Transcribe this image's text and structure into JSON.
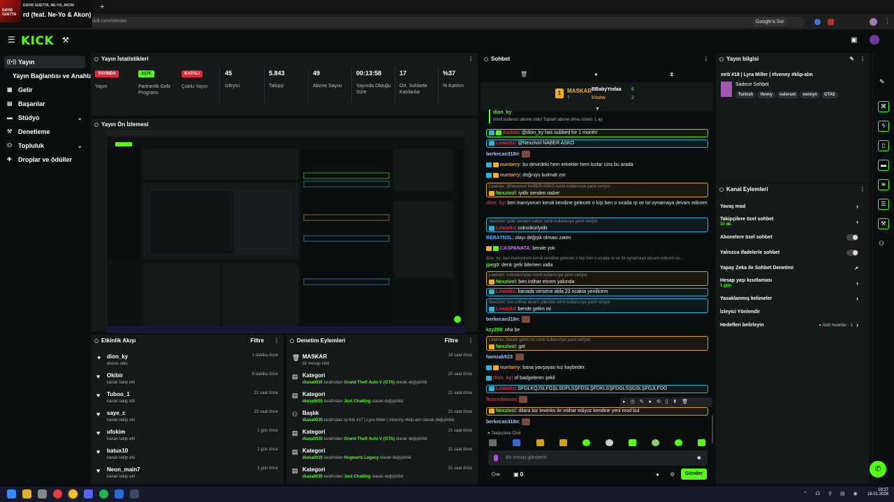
{
  "media": {
    "artist": "DAVID GUETTA, NE-YO, AKON",
    "song": "rd (feat. Ne-Yo & Akon)",
    "art_label": "DAVID GUETTA"
  },
  "browser": {
    "url": "dashboard.kick.com/stream",
    "ask_label": "Google'a Sor"
  },
  "brand": {
    "logo": "KICK",
    "accent": "#53fc18"
  },
  "sidebar": {
    "items": [
      {
        "label": "Yayın",
        "icon": "broadcast-icon"
      },
      {
        "label": "Yayın Bağlantısı ve Anahtarı"
      },
      {
        "label": "Gelir",
        "icon": "grid-icon"
      },
      {
        "label": "Başarılar",
        "icon": "trophy-icon"
      },
      {
        "label": "Stüdyo",
        "icon": "studio-icon",
        "expand": true
      },
      {
        "label": "Denetleme",
        "icon": "wrench-icon"
      },
      {
        "label": "Topluluk",
        "icon": "people-icon",
        "expand": true
      },
      {
        "label": "Droplar ve ödüller",
        "icon": "gift-icon"
      }
    ]
  },
  "stats": {
    "title": "Yayın İstatistikleri",
    "items": [
      {
        "badge": "YAYINDA",
        "label": "Yayın",
        "color": "#e0283a"
      },
      {
        "badge": "AÇIK",
        "label": "Partnerlik Gelir Programı",
        "color": "#53fc18"
      },
      {
        "badge": "KAPALI",
        "label": "Çoklu Yayın",
        "color": "#e0283a"
      },
      {
        "value": "45",
        "label": "İzleyici"
      },
      {
        "value": "5.843",
        "label": "Takipçi"
      },
      {
        "value": "49",
        "label": "Abone Sayısı"
      },
      {
        "value": "00:13:58",
        "label": "Yayında Olduğu Süre"
      },
      {
        "value": "17",
        "label": "Ort. Sohbete Katılanlar"
      },
      {
        "value": "%37",
        "label": "% Katılım"
      }
    ]
  },
  "preview": {
    "title": "Yayın Ön İzlemesi"
  },
  "activity": {
    "title": "Etkinlik Akışı",
    "filter": "Filtre",
    "items": [
      {
        "name": "dion_ky",
        "sub": "abone oldu",
        "time": "1 dakika önce",
        "icon": "star-icon"
      },
      {
        "name": "Okibir",
        "sub": "kanalı takip etti",
        "time": "8 dakika önce",
        "icon": "heart-icon"
      },
      {
        "name": "Tuboo_1",
        "sub": "kanalı takip etti",
        "time": "21 saat önce",
        "icon": "heart-icon"
      },
      {
        "name": "saye_c",
        "sub": "kanalı takip etti",
        "time": "23 saat önce",
        "icon": "heart-icon"
      },
      {
        "name": "ufokim",
        "sub": "kanalı takip etti",
        "time": "1 gün önce",
        "icon": "heart-icon"
      },
      {
        "name": "batux10",
        "sub": "kanalı takip etti",
        "time": "1 gün önce",
        "icon": "heart-icon"
      },
      {
        "name": "Neon_main7",
        "sub": "kanalı takip etti",
        "time": "1 gün önce",
        "icon": "heart-icon"
      }
    ]
  },
  "moderation": {
    "title": "Denetim Eylemleri",
    "filter": "Filtre",
    "items": [
      {
        "title": "MASKAR",
        "user": "",
        "mid": "bir mesajı sildi",
        "target": "",
        "end": "",
        "time": "19 saat önce"
      },
      {
        "title": "Kategori",
        "user": "diana0035",
        "mid": " tarafından ",
        "target": "Grand Theft Auto V (GTA)",
        "end": " olarak değiştirildi",
        "time": "20 saat önce"
      },
      {
        "title": "Kategori",
        "user": "diana0035",
        "mid": " tarafından ",
        "target": "Just Chatting",
        "end": " olarak değiştirildi",
        "time": "21 saat önce"
      },
      {
        "title": "Başlık",
        "user": "diana0035",
        "mid": " tarafından ",
        "target": "",
        "end": "rp link #17 | Lyra Miller | #lvenny #klip-alın olarak değiştirildi",
        "time": "21 saat önce"
      },
      {
        "title": "Kategori",
        "user": "diana0035",
        "mid": " tarafından ",
        "target": "Grand Theft Auto V (GTA)",
        "end": " olarak değiştirildi",
        "time": "21 saat önce"
      },
      {
        "title": "Kategori",
        "user": "diana0035",
        "mid": " tarafından ",
        "target": "Hogwarts Legacy",
        "end": " olarak değiştirildi",
        "time": "21 saat önce"
      },
      {
        "title": "Kategori",
        "user": "diana0035",
        "mid": " tarafından ",
        "target": "Just Chatting",
        "end": " olarak değiştirildi",
        "time": "21 saat önce"
      }
    ]
  },
  "chat": {
    "title": "Sohbet",
    "gifters": {
      "first": "MASKAR",
      "first_count": "7",
      "second": "BBabyYodaa",
      "second_count": "6",
      "third": "kitatw",
      "third_count": "2"
    },
    "pinned_user": "dion_ky",
    "pinned_text": "isimli kullanıcı abone oldu! Toplam abone olma süresi: 1 ay.",
    "messages": [
      {
        "user": "Kickibi",
        "ucolor": "#e0283a",
        "text": ": @dion_ky has subbed for 1 month!",
        "style": "hl-g"
      },
      {
        "user": "Lewinks",
        "ucolor": "#e0283a",
        "text": ": @Nexzivol NABER ASKO",
        "style": "hl-b"
      },
      {
        "user": "berkecan318n",
        "ucolor": "#9fc4ff",
        "text": ":",
        "emote": true
      },
      {
        "user": "nuntarry",
        "ucolor": "#f0a020",
        "text": ": bu devirdeki hem erkekler hem kızlar cins bu arada"
      },
      {
        "user": "nuntarry",
        "ucolor": "#f0a020",
        "text": ": doğruyu bulmak zor"
      },
      {
        "reply": "Lewinks: @Nexzivol NABER ASKO isimli kullanıcıya yanıt veriyor",
        "user": "Nexzivol",
        "ucolor": "#53fc18",
        "text": ": iyidir senden naber",
        "style": "hl-y"
      },
      {
        "user": "dion_ky",
        "ucolor": "#e0283a",
        "text": ": ben inanıyorum kendi kendine gelecek o kişi ben o sırada rp ve lol oynamaya devam edicem",
        "wrap": true
      },
      {
        "reply": "Nexzivol: iyidir senden naber isimli kullanıcıya yanıt veriyor",
        "user": "Lewinks",
        "ucolor": "#e0283a",
        "text": ": coksükürlyidir",
        "style": "hl-b"
      },
      {
        "user": "BERATNSL",
        "ucolor": "#5ab0ff",
        "text": ": olayı değişik olması zaten"
      },
      {
        "user": "CASPANATA",
        "ucolor": "#d070ff",
        "text": ": bende yok"
      },
      {
        "reply": "dion_ky: ben inanıyorum kendi kendine gelecek o kişi ben o sırada rp ve lol oynamaya devam edicem isi...",
        "user": "jpeg0",
        "ucolor": "#53fc18",
        "text": ": denk gelir bilemen valla"
      },
      {
        "reply": "Lewinks: coksükürlyidir isimli kullanıcıya yanıt veriyor",
        "user": "Nexzivol",
        "ucolor": "#53fc18",
        "text": ": ben intihar etcem yakında",
        "style": "hl-y"
      },
      {
        "user": "Lewinks",
        "ucolor": "#e0283a",
        "text": ": banada versene abla 23 ocakta yenilicem",
        "style": "hl-b"
      },
      {
        "reply": "Nexzivol: ben intihar etcem yakında isimli kullanıcıya yanıt veriyor",
        "user": "Lewinks",
        "ucolor": "#e0283a",
        "text": ": bende gelim mi",
        "style": "hl-b"
      },
      {
        "user": "berkecan318n",
        "ucolor": "#9fc4ff",
        "text": ":",
        "emote": true
      },
      {
        "user": "kzy289",
        "ucolor": "#53fc18",
        "text": ": oha be"
      },
      {
        "reply": "Lewinks: bende gelim mi isimli kullanıcıya yanıt veriyor",
        "user": "Nexzivol",
        "ucolor": "#53fc18",
        "text": ": gel",
        "style": "hl-y"
      },
      {
        "user": "hamzab523",
        "ucolor": "#9fc4ff",
        "text": ":",
        "emote": true
      },
      {
        "user": "nuntarry",
        "ucolor": "#f0a020",
        "text": ": bana yavşayan kız kaybeder"
      },
      {
        "user": "dion_ky",
        "ucolor": "#e0283a",
        "text": ": of badgelerim şekil"
      },
      {
        "user": "Lewinks",
        "ucolor": "#e0283a",
        "text": ": SFDLKQJSLFGŞLSDFLSŞFDSLŞFDKLSŞFDGLSŞGSLŞFGJLFDG",
        "style": "hl-b"
      },
      {
        "user": "lkmcedmoon",
        "ucolor": "#e0283a",
        "text": ":",
        "emote": true
      },
      {
        "user": "Nexzivol",
        "ucolor": "#53fc18",
        "text": ": dilara biz lewinks ile intihar ediyoz kendine yeni mod bul",
        "style": "hl-y"
      },
      {
        "user": "berkecan318n",
        "ucolor": "#9fc4ff",
        "text": ":",
        "emote": true
      }
    ],
    "followers_label": "Takipçilere Özel",
    "input_placeholder": "Bir mesaj gönderin",
    "points": "0",
    "send": "Gönder"
  },
  "stream_info": {
    "title": "Yayın bilgisi",
    "stream_title": "mrb #18 | Lyra Miller | #lvenny #klip-alın",
    "category": "Sadece Sohbet",
    "tags": [
      "Turkish",
      "Venny",
      "valorant",
      "vennyv",
      "GTA5"
    ]
  },
  "channel_actions": {
    "title": "Kanal Eylemleri",
    "items": [
      {
        "label": "Yavaş mod",
        "type": "chevron"
      },
      {
        "label": "Takipçilere özel sohbet",
        "sub": "10 dk.",
        "type": "chevron"
      },
      {
        "label": "Abonelere özel sohbet",
        "type": "toggle"
      },
      {
        "label": "Yalnızca ifadelerle sohbet",
        "type": "toggle"
      },
      {
        "label": "Yapay Zeka ile Sohbet Denetimi",
        "type": "external"
      },
      {
        "label": "Hesap yaşı kısıtlaması",
        "sub": "1 gün",
        "type": "chevron"
      },
      {
        "label": "Yasaklanmış kelimeler",
        "type": "chevron"
      },
      {
        "label": "İzleyici Yönlendir",
        "type": "none"
      },
      {
        "label": "Hedefleri belirleyin",
        "type": "chevron",
        "status": "Aktif hedefler - 1"
      }
    ]
  },
  "taskbar": {
    "time": "19:27",
    "date": "18.01.2026"
  }
}
